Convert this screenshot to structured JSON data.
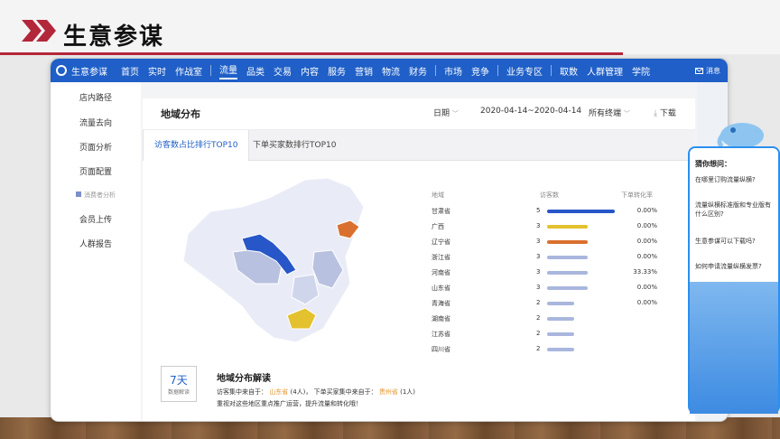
{
  "slide": {
    "title": "生意参谋"
  },
  "nav": {
    "brand": "生意参谋",
    "items": [
      "首页",
      "实时",
      "作战室",
      "流量",
      "品类",
      "交易",
      "内容",
      "服务",
      "营销",
      "物流",
      "财务",
      "市场",
      "竞争",
      "业务专区",
      "取数",
      "人群管理",
      "学院"
    ],
    "active": "流量",
    "message": "消息"
  },
  "sidebar": {
    "items": [
      "店内路径",
      "流量去向",
      "页面分析",
      "页面配置"
    ],
    "section": "消费者分析",
    "items2": [
      "会员上传",
      "人群报告"
    ]
  },
  "panel": {
    "title": "地域分布",
    "date_label": "日期",
    "date_range": "2020-04-14~2020-04-14",
    "terminal": "所有终端",
    "download": "下载",
    "tabs": [
      "访客数占比排行TOP10",
      "下单买家数排行TOP10"
    ]
  },
  "table": {
    "headers": {
      "region": "地域",
      "visitors": "访客数",
      "conversion": "下单转化率"
    },
    "rows": [
      {
        "province": "甘肃省",
        "count": "5",
        "rate": "0.00%",
        "fraction": 1.0,
        "color": "#2756c8"
      },
      {
        "province": "广西",
        "count": "3",
        "rate": "0.00%",
        "fraction": 0.6,
        "color": "#e4c12e"
      },
      {
        "province": "辽宁省",
        "count": "3",
        "rate": "0.00%",
        "fraction": 0.6,
        "color": "#d9702f"
      },
      {
        "province": "浙江省",
        "count": "3",
        "rate": "0.00%",
        "fraction": 0.6,
        "color": "#a9b6dd"
      },
      {
        "province": "河南省",
        "count": "3",
        "rate": "33.33%",
        "fraction": 0.6,
        "color": "#a9b6dd"
      },
      {
        "province": "山东省",
        "count": "3",
        "rate": "0.00%",
        "fraction": 0.6,
        "color": "#a9b6dd"
      },
      {
        "province": "青海省",
        "count": "2",
        "rate": "0.00%",
        "fraction": 0.4,
        "color": "#a9b6dd"
      },
      {
        "province": "湖南省",
        "count": "2",
        "rate": "",
        "fraction": 0.4,
        "color": "#a9b6dd"
      },
      {
        "province": "江苏省",
        "count": "2",
        "rate": "",
        "fraction": 0.4,
        "color": "#a9b6dd"
      },
      {
        "province": "四川省",
        "count": "2",
        "rate": "",
        "fraction": 0.4,
        "color": "#a9b6dd"
      }
    ]
  },
  "analysis": {
    "badge_big": "7天",
    "badge_small": "数据解读",
    "title": "地域分布解读",
    "line1_prefix": "访客集中来自于：",
    "line1_prov": "山东省",
    "line1_count": "(4人)，",
    "line1_mid": "下单买家集中来自于：",
    "line1_prov2": "贵州省",
    "line1_count2": "(1人)",
    "line2": "重视对这些地区重点推广运营，提升流量和转化哦！"
  },
  "widget": {
    "title": "猜你想问：",
    "questions": [
      "在哪里订购流量纵横?",
      "流量纵横标准版和专业版有什么区别?",
      "生意参谋可以下载吗?",
      "如何申请流量纵横发票?"
    ]
  }
}
